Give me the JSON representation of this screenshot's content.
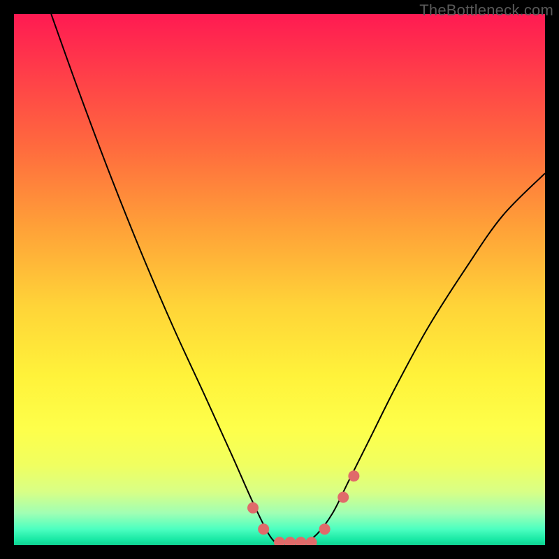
{
  "watermark": "TheBottleneck.com",
  "chart_data": {
    "type": "line",
    "title": "",
    "xlabel": "",
    "ylabel": "",
    "xlim": [
      0,
      100
    ],
    "ylim": [
      0,
      100
    ],
    "grid": false,
    "series": [
      {
        "name": "bottleneck-curve",
        "color": "#000000",
        "x": [
          7,
          12,
          18,
          24,
          30,
          36,
          41,
          45,
          48,
          50,
          52,
          54,
          57,
          60,
          63,
          67,
          72,
          78,
          85,
          92,
          100
        ],
        "y": [
          100,
          86,
          70,
          55,
          41,
          28,
          17,
          8,
          2,
          0,
          0,
          0,
          2,
          6,
          12,
          20,
          30,
          41,
          52,
          62,
          70
        ]
      }
    ],
    "markers": [
      {
        "name": "marker-left-1",
        "x": 45.0,
        "y": 7.0
      },
      {
        "name": "marker-left-2",
        "x": 47.0,
        "y": 3.0
      },
      {
        "name": "marker-flat-1",
        "x": 50.0,
        "y": 0.5
      },
      {
        "name": "marker-flat-2",
        "x": 52.0,
        "y": 0.5
      },
      {
        "name": "marker-flat-3",
        "x": 54.0,
        "y": 0.5
      },
      {
        "name": "marker-flat-4",
        "x": 56.0,
        "y": 0.5
      },
      {
        "name": "marker-right-1",
        "x": 58.5,
        "y": 3.0
      },
      {
        "name": "marker-right-2",
        "x": 62.0,
        "y": 9.0
      },
      {
        "name": "marker-right-3",
        "x": 64.0,
        "y": 13.0
      }
    ],
    "marker_style": {
      "fill": "#e06a6a",
      "radius_px": 8
    },
    "background_gradient": {
      "top": "#ff1a52",
      "upper_mid": "#ffc038",
      "lower_mid": "#feff4a",
      "bottom": "#10d090"
    }
  }
}
